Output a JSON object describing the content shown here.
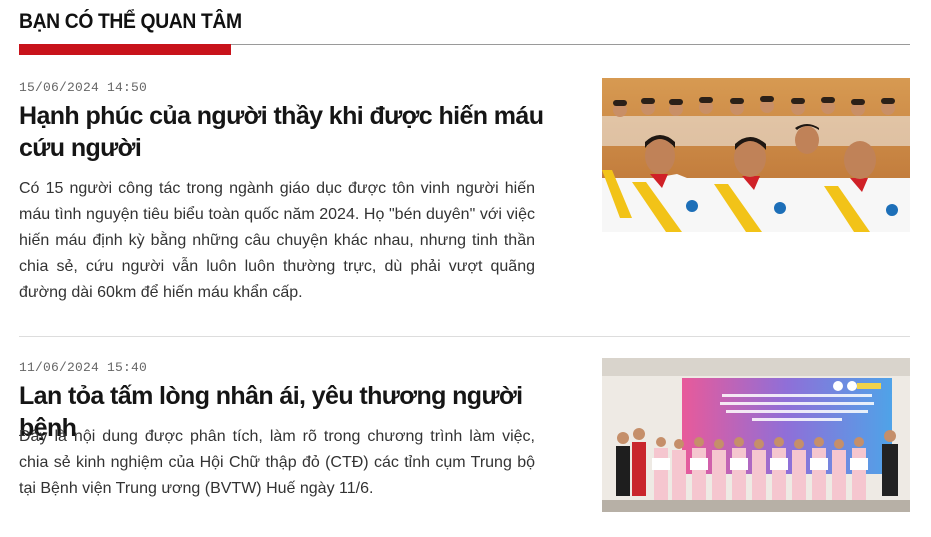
{
  "section": {
    "title": "BẠN CÓ THỂ QUAN TÂM"
  },
  "articles": [
    {
      "time": "15/06/2024 14:50",
      "title": "Hạnh phúc của người thầy khi được hiến máu cứu người",
      "summary": "Có 15 người công tác trong ngành giáo dục được tôn vinh người hiến máu tình nguyện tiêu biểu toàn quốc năm 2024. Họ \"bén duyên\" với việc hiến máu định kỳ bằng những câu chuyện khác nhau, nhưng tinh thần chia sẻ, cứu người vẫn luôn luôn thường trực, dù phải vượt quãng đường dài 60km để hiến máu khẩn cấp."
    },
    {
      "time": "11/06/2024 15:40",
      "title": "Lan tỏa tấm lòng nhân ái, yêu thương người bệnh",
      "summary": "Đây là nội dung được phân tích, làm rõ trong chương trình làm việc, chia sẻ kinh nghiệm của Hội Chữ thập đỏ (CTĐ) các tỉnh cụm Trung bộ tại Bệnh viện Trung ương (BVTW) Huế ngày 11/6."
    }
  ],
  "colors": {
    "accent": "#c8131b",
    "rule": "#9a9a9a",
    "sash": "#f2c318"
  }
}
